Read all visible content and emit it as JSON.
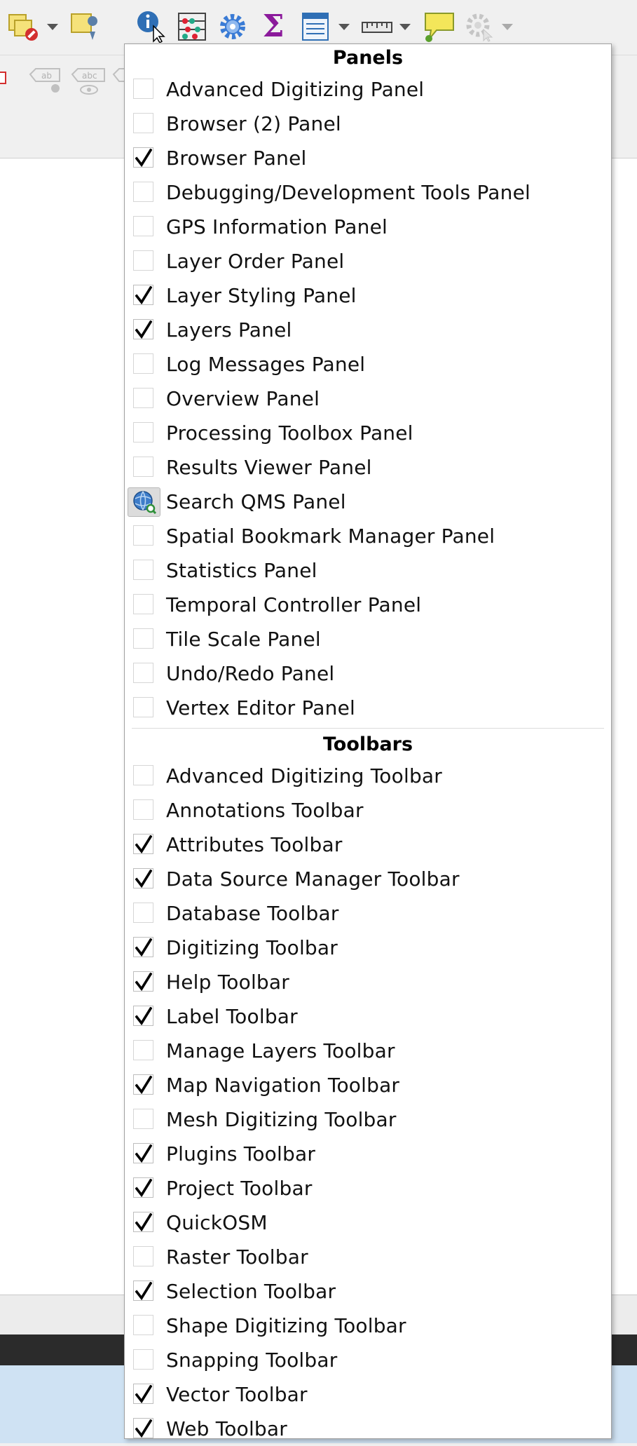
{
  "menu": {
    "panels_header": "Panels",
    "toolbars_header": "Toolbars",
    "panels": [
      {
        "label": "Advanced Digitizing Panel",
        "checked": false
      },
      {
        "label": "Browser (2) Panel",
        "checked": false
      },
      {
        "label": "Browser Panel",
        "checked": true
      },
      {
        "label": "Debugging/Development Tools Panel",
        "checked": false
      },
      {
        "label": "GPS Information Panel",
        "checked": false
      },
      {
        "label": "Layer Order Panel",
        "checked": false
      },
      {
        "label": "Layer Styling Panel",
        "checked": true
      },
      {
        "label": "Layers Panel",
        "checked": true
      },
      {
        "label": "Log Messages Panel",
        "checked": false
      },
      {
        "label": "Overview Panel",
        "checked": false
      },
      {
        "label": "Processing Toolbox Panel",
        "checked": false
      },
      {
        "label": "Results Viewer Panel",
        "checked": false
      },
      {
        "label": "Search QMS Panel",
        "checked": false,
        "icon": "qms-globe-search-icon"
      },
      {
        "label": "Spatial Bookmark Manager Panel",
        "checked": false
      },
      {
        "label": "Statistics Panel",
        "checked": false
      },
      {
        "label": "Temporal Controller Panel",
        "checked": false
      },
      {
        "label": "Tile Scale Panel",
        "checked": false
      },
      {
        "label": "Undo/Redo Panel",
        "checked": false
      },
      {
        "label": "Vertex Editor Panel",
        "checked": false
      }
    ],
    "toolbars": [
      {
        "label": "Advanced Digitizing Toolbar",
        "checked": false
      },
      {
        "label": "Annotations Toolbar",
        "checked": false
      },
      {
        "label": "Attributes Toolbar",
        "checked": true
      },
      {
        "label": "Data Source Manager Toolbar",
        "checked": true
      },
      {
        "label": "Database Toolbar",
        "checked": false
      },
      {
        "label": "Digitizing Toolbar",
        "checked": true
      },
      {
        "label": "Help Toolbar",
        "checked": true
      },
      {
        "label": "Label Toolbar",
        "checked": true
      },
      {
        "label": "Manage Layers Toolbar",
        "checked": false
      },
      {
        "label": "Map Navigation Toolbar",
        "checked": true
      },
      {
        "label": "Mesh Digitizing Toolbar",
        "checked": false
      },
      {
        "label": "Plugins Toolbar",
        "checked": true
      },
      {
        "label": "Project Toolbar",
        "checked": true
      },
      {
        "label": "QuickOSM",
        "checked": true
      },
      {
        "label": "Raster Toolbar",
        "checked": false
      },
      {
        "label": "Selection Toolbar",
        "checked": true
      },
      {
        "label": "Shape Digitizing Toolbar",
        "checked": false
      },
      {
        "label": "Snapping Toolbar",
        "checked": false
      },
      {
        "label": "Vector Toolbar",
        "checked": true
      },
      {
        "label": "Web Toolbar",
        "checked": true
      }
    ]
  },
  "toolbar_icons": [
    "deselect-features-icon",
    "select-location-icon",
    "identify-features-icon",
    "attribute-table-icon",
    "settings-gear-icon",
    "statistics-sigma-icon",
    "open-table-icon",
    "measure-ruler-icon",
    "map-tips-icon",
    "action-gear-icon",
    "label-ab-icon",
    "label-abc-pin-icon",
    "label-abc-eye-icon"
  ],
  "colors": {
    "accent_blue": "#2f6fb5",
    "sigma_purple": "#8b1a9b",
    "tooltip_yellow": "#f3e65a",
    "check_black": "#000000"
  }
}
